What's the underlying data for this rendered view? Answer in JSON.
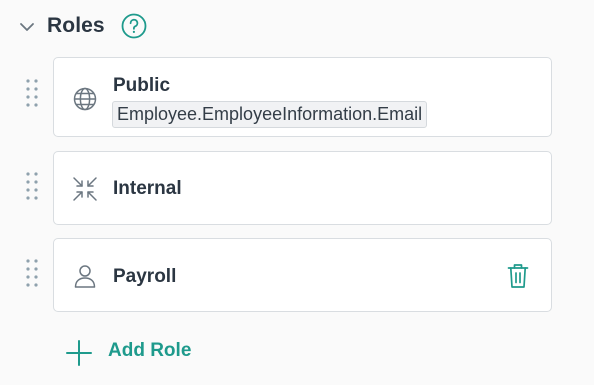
{
  "section": {
    "title": "Roles",
    "icons": {
      "collapse": "chevron-down-icon",
      "help": "help-circle-icon"
    }
  },
  "roles": [
    {
      "name": "Public",
      "icon": "globe-icon",
      "field": "Employee.EmployeeInformation.Email"
    },
    {
      "name": "Internal",
      "icon": "arrows-collapse-icon"
    },
    {
      "name": "Payroll",
      "icon": "user-icon",
      "action_icon": "trash-icon"
    }
  ],
  "add_role": {
    "label": "Add Role",
    "icon": "plus-icon"
  },
  "colors": {
    "accent": "#1e9a8c",
    "text": "#2b3642",
    "muted": "#6b7680",
    "border": "#d9dde1"
  }
}
